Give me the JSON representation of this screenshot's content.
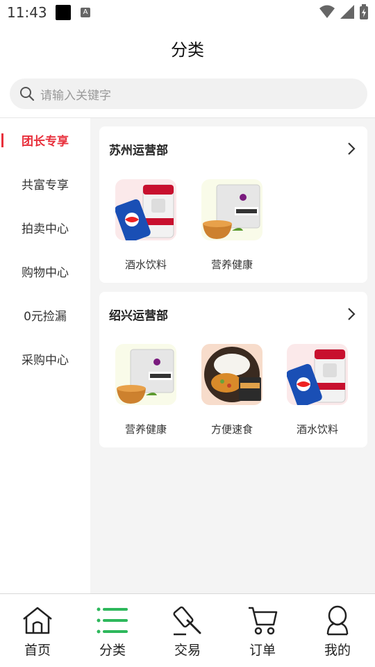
{
  "status_bar": {
    "time": "11:43",
    "a_icon": "A"
  },
  "header": {
    "title": "分类"
  },
  "search": {
    "placeholder": "请输入关键字"
  },
  "sidebar": {
    "items": [
      {
        "label": "团长专享",
        "active": true
      },
      {
        "label": "共富专享"
      },
      {
        "label": "拍卖中心"
      },
      {
        "label": "购物中心"
      },
      {
        "label": "0元捡漏"
      },
      {
        "label": "采购中心"
      }
    ]
  },
  "sections": [
    {
      "title": "苏州运营部",
      "categories": [
        {
          "label": "酒水饮料",
          "icon": "drinks-image"
        },
        {
          "label": "营养健康",
          "icon": "nutrition-image"
        }
      ]
    },
    {
      "title": "绍兴运营部",
      "categories": [
        {
          "label": "营养健康",
          "icon": "nutrition-image"
        },
        {
          "label": "方便速食",
          "icon": "instant-food-image"
        },
        {
          "label": "酒水饮料",
          "icon": "drinks-image"
        }
      ]
    }
  ],
  "bottom_nav": [
    {
      "label": "首页",
      "icon": "home-icon"
    },
    {
      "label": "分类",
      "icon": "category-icon",
      "active": true
    },
    {
      "label": "交易",
      "icon": "auction-hammer-icon"
    },
    {
      "label": "订单",
      "icon": "cart-icon"
    },
    {
      "label": "我的",
      "icon": "user-icon"
    }
  ],
  "colors": {
    "accent_red": "#e8303c",
    "accent_green": "#2eb85c"
  }
}
